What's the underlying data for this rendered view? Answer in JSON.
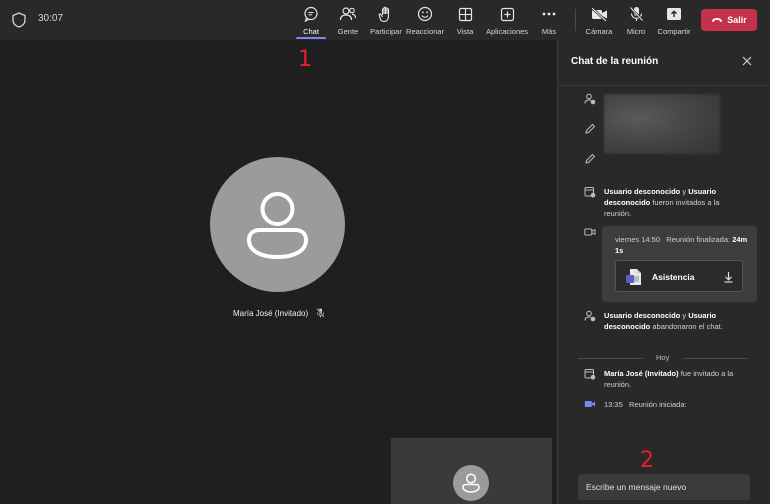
{
  "header": {
    "timer": "30:07",
    "buttons": {
      "chat": "Chat",
      "people": "Gente",
      "raise": "Participar",
      "react": "Reaccionar",
      "view": "Vista",
      "apps": "Aplicaciones",
      "more": "Más",
      "camera": "Cámara",
      "mic": "Micro",
      "share": "Compartir"
    },
    "leave_label": "Salir"
  },
  "stage": {
    "annotation": "1",
    "participant_name": "María José (Invitado)"
  },
  "chat_panel": {
    "title": "Chat de la reunión",
    "event_invited": {
      "name1": "Usuario desconocido",
      "conj": " y ",
      "name2": "Usuario desconocido",
      "rest": " fueron invitados a la reunión."
    },
    "meeting_card": {
      "time": "viernes 14:50",
      "ended_label": "Reunión finalizada:",
      "duration": "24m 1s",
      "attendance_label": "Asistencia"
    },
    "event_left": {
      "name1": "Usuario desconocido",
      "conj": " y ",
      "name2": "Usuario desconocido",
      "rest": " abandonaron el chat."
    },
    "day_separator": "Hoy",
    "event_guest": {
      "name": "María José (Invitado)",
      "rest": " fue invitado a la reunión."
    },
    "event_started": {
      "time": "13:35",
      "text": "Reunión iniciada:"
    },
    "compose_placeholder": "Escribe un mensaje nuevo",
    "annotation": "2"
  },
  "colors": {
    "accent": "#7f85f5",
    "leave": "#c4314b",
    "annotation": "#e8202a"
  }
}
